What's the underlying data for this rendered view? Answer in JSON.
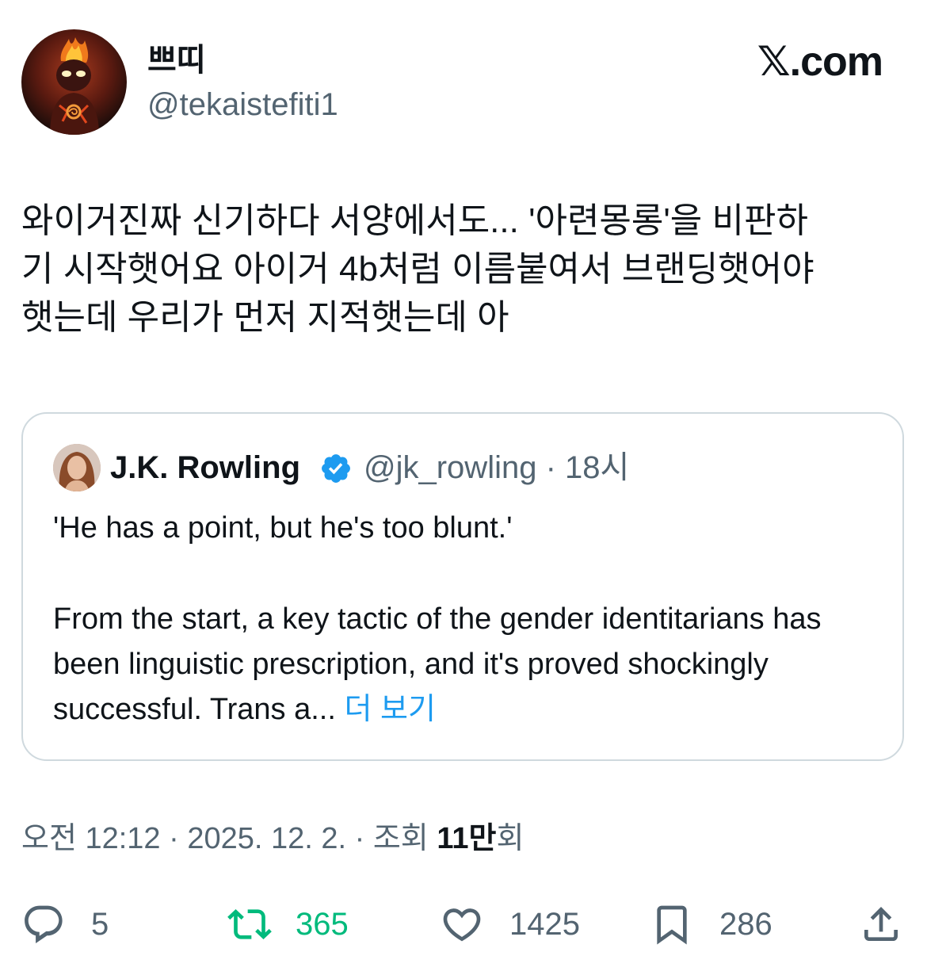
{
  "author": {
    "display_name": "쁘띠",
    "handle": "@tekaistefiti1",
    "avatar_icon": "fire-demon-avatar"
  },
  "brand": {
    "label": "𝕏.com"
  },
  "tweet": {
    "text": "와이거진짜 신기하다 서양에서도... '아련몽롱'을 비판하\n기 시작햇어요 아이거 4b처럼 이름붙여서 브랜딩햇어야\n햇는데 우리가 먼저 지적햇는데 아"
  },
  "quoted_tweet": {
    "author_name": "J.K. Rowling",
    "verified_icon": "verified-badge-icon",
    "handle_time": "@jk_rowling · 18시",
    "line1": "'He has a point, but he's too blunt.'",
    "paragraph2": "From the start, a key tactic of the gender identitarians has been linguistic prescription, and it's proved shockingly successful. Trans a...",
    "more_label": "더 보기"
  },
  "meta": {
    "timestamp": "오전 12:12 · 2025. 12. 2. · 조회 ",
    "views_number": "11만",
    "views_suffix": "회"
  },
  "actions": {
    "replies": "5",
    "retweets": "365",
    "likes": "1425",
    "bookmarks": "286"
  },
  "colors": {
    "text": "#0f1419",
    "secondary": "#536471",
    "link": "#1d9bf0",
    "retweet_active": "#00ba7c",
    "border": "#cfd9de"
  }
}
